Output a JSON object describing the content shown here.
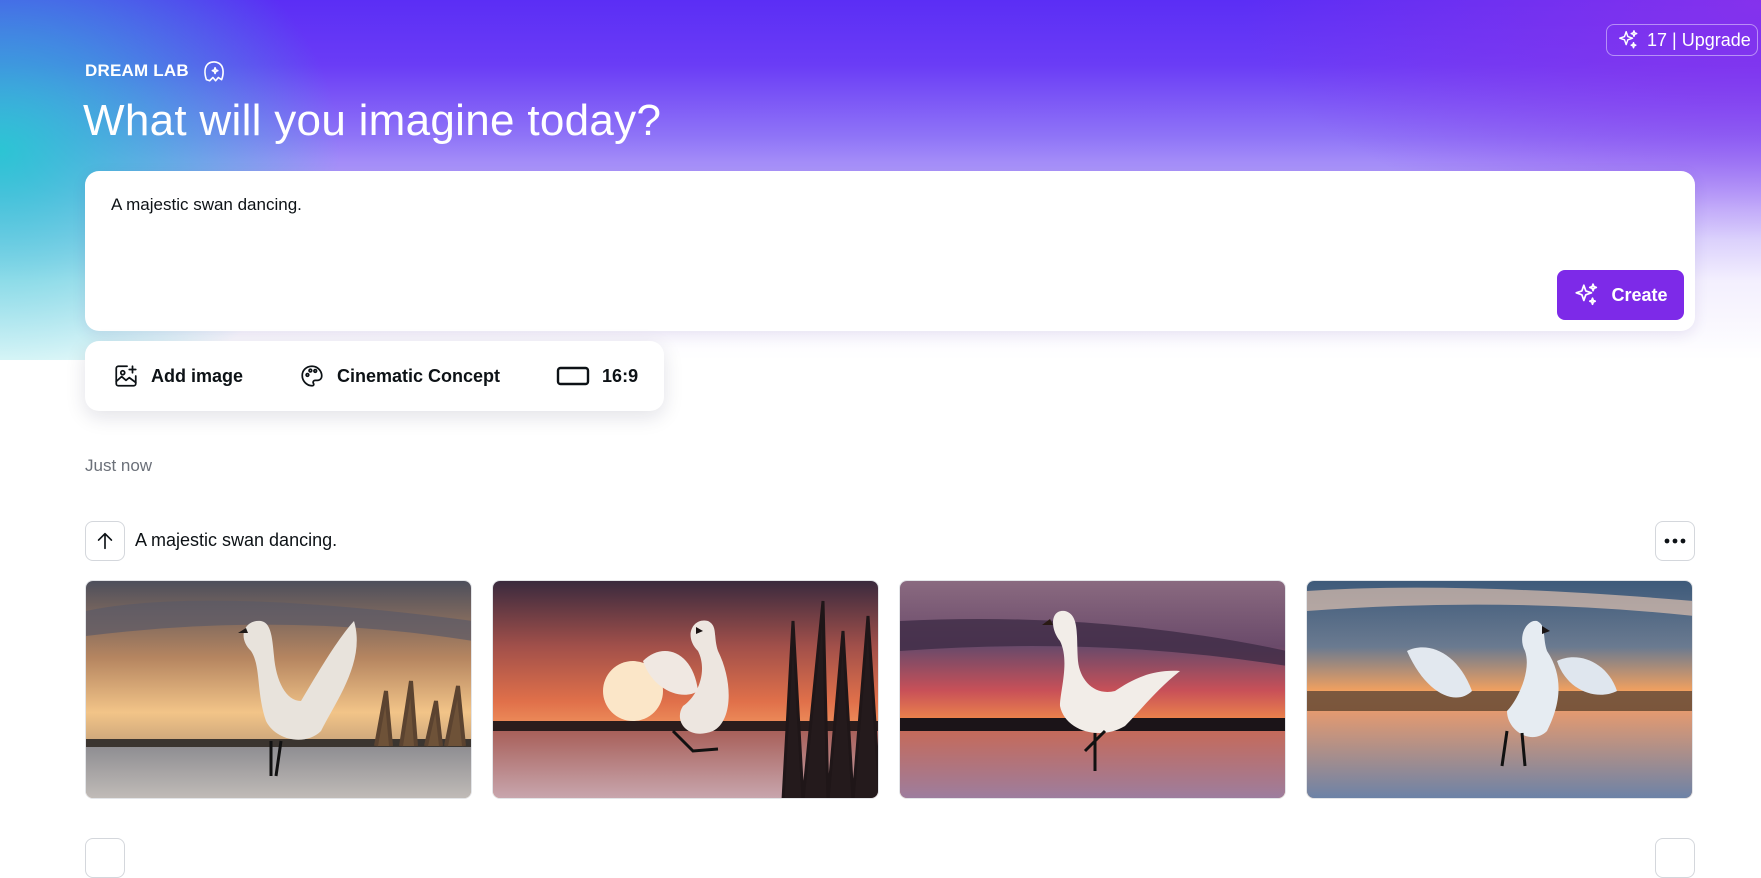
{
  "header": {
    "credits_label": "17 | Upgrade",
    "brand": "DREAM LAB",
    "title": "What will you imagine today?"
  },
  "prompt": {
    "value": "A majestic swan dancing.",
    "create_label": "Create"
  },
  "options": {
    "add_image": "Add image",
    "style": "Cinematic Concept",
    "aspect_ratio": "16:9"
  },
  "history": {
    "timestamp": "Just now",
    "prompt": "A majestic swan dancing.",
    "images": [
      {
        "name": "swan-image-1"
      },
      {
        "name": "swan-image-2"
      },
      {
        "name": "swan-image-3"
      },
      {
        "name": "swan-image-4"
      }
    ]
  },
  "colors": {
    "accent": "#7d2ae8",
    "header_top": "#5b2ef5",
    "header_teal": "#26c8d2"
  },
  "icons": {
    "upgrade": "sparkle-icon",
    "brand": "dream-lab-icon",
    "create": "sparkle-icon",
    "add_image": "image-add-icon",
    "style": "palette-icon",
    "aspect": "rectangle-icon",
    "reuse": "arrow-up-icon",
    "more": "more-horizontal-icon"
  }
}
